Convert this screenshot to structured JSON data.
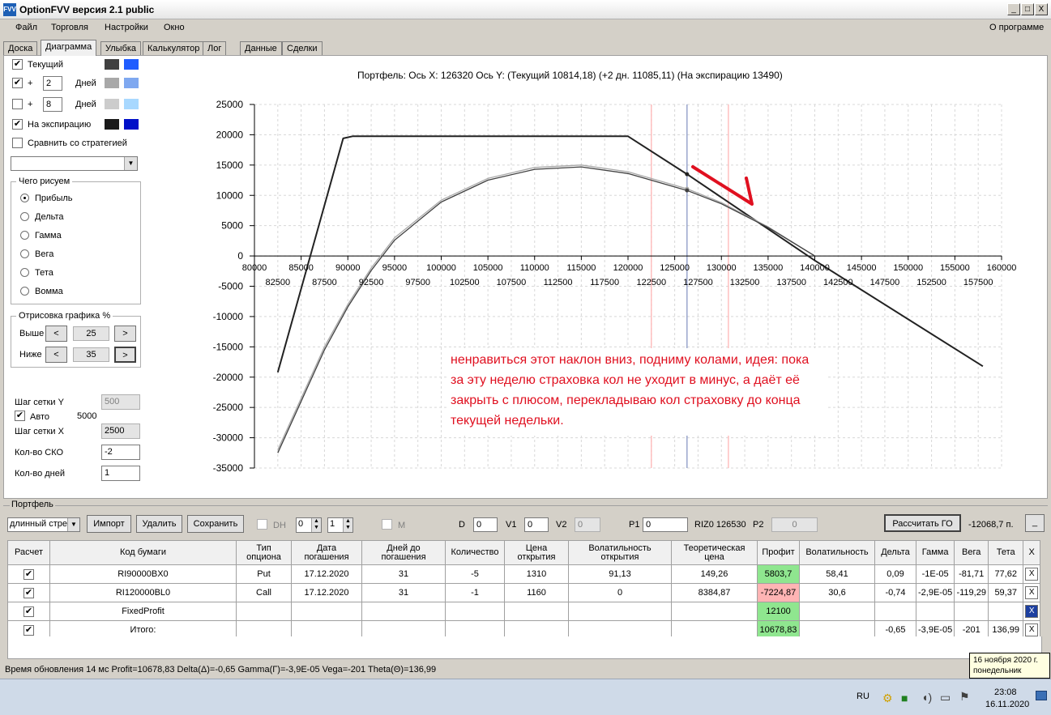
{
  "window": {
    "title": "OptionFVV версия 2.1 public",
    "icon_name": "app-logo-icon",
    "min_label": "_",
    "max_label": "□",
    "close_label": "X"
  },
  "menu": {
    "items": [
      "Файл",
      "Торговля",
      "Настройки",
      "Окно"
    ],
    "about": "О программе"
  },
  "tabs": [
    "Доска",
    "Диаграмма",
    "Улыбка",
    "Калькулятор",
    "Лог",
    "Данные",
    "Сделки"
  ],
  "active_tab": "Диаграмма",
  "left_panel": {
    "current": {
      "label": "Текущий",
      "checked": true,
      "color1": "#404040",
      "color2": "#1f5cff"
    },
    "plus1": {
      "prefix": "+",
      "value": "2",
      "unit": "Дней",
      "checked": true,
      "color1": "#a8a8a8",
      "color2": "#7fa8f0"
    },
    "plus2": {
      "prefix": "+",
      "value": "8",
      "unit": "Дней",
      "checked": false,
      "color1": "#cccccc",
      "color2": "#a8d8ff"
    },
    "expiry": {
      "label": "На экспирацию",
      "checked": true,
      "color1": "#1a1a1a",
      "color2": "#0010c8"
    },
    "compare": {
      "label": "Сравнить со стратегией",
      "checked": false
    },
    "draw_group": {
      "title": "Чего рисуем",
      "options": [
        "Прибыль",
        "Дельта",
        "Гамма",
        "Вега",
        "Тета",
        "Вомма"
      ],
      "selected": "Прибыль"
    },
    "render_group": {
      "title": "Отрисовка графика %",
      "above_label": "Выше",
      "above_value": "25",
      "below_label": "Ниже",
      "below_value": "35",
      "left_arrow": "<",
      "right_arrow": ">"
    },
    "grid_y_label": "Шаг сетки Y",
    "grid_y_value": "500",
    "auto_label": "Авто",
    "auto_checked": true,
    "auto_value": "5000",
    "grid_x_label": "Шаг сетки X",
    "grid_x_value": "2500",
    "sko_label": "Кол-во СКО",
    "sko_value": "-2",
    "days_label": "Кол-во дней",
    "days_value": "1"
  },
  "chart_title": "Портфель: Ось X: 126320 Ось Y:  (Текущий 10814,18)  (+2 дн. 11085,11)  (На экспирацию 13490)",
  "annotation": "ненравиться этот наклон вниз, подниму колами, идея: пока за эту неделю страховка кол не уходит в минус, а даёт её закрыть с плюсом, перекладываю кол страховку до конца текущей недельки.",
  "chart_data": {
    "type": "line",
    "xlim": [
      80000,
      160000
    ],
    "ylim": [
      -35000,
      25000
    ],
    "x_ticks_top": [
      "80000",
      "85000",
      "90000",
      "95000",
      "100000",
      "105000",
      "110000",
      "115000",
      "120000",
      "125000",
      "130000",
      "135000",
      "140000",
      "145000",
      "150000",
      "155000",
      "160000"
    ],
    "x_ticks_bottom": [
      "82500",
      "87500",
      "92500",
      "97500",
      "102500",
      "107500",
      "112500",
      "117500",
      "122500",
      "127500",
      "132500",
      "137500",
      "142500",
      "147500",
      "152500",
      "157500"
    ],
    "y_ticks": [
      "25000",
      "20000",
      "15000",
      "10000",
      "5000",
      "0",
      "-5000",
      "-10000",
      "-15000",
      "-20000",
      "-25000",
      "-30000",
      "-35000"
    ],
    "cursor_x": 126320,
    "red_lines_x": [
      122500,
      130750
    ],
    "series": [
      {
        "color": "#222222",
        "x": [
          82500,
          89500,
          90500,
          120000,
          126320,
          140000,
          158000
        ],
        "y": [
          -19200,
          19400,
          19750,
          19750,
          13490,
          -750,
          -18200
        ]
      },
      {
        "color": "#a8a8a8",
        "x": [
          82500,
          85000,
          87500,
          90000,
          92500,
          95000,
          100000,
          105000,
          110000,
          115000,
          120000,
          126320,
          130000,
          135000,
          140000
        ],
        "y": [
          -32000,
          -23500,
          -15000,
          -8000,
          -2000,
          3000,
          9200,
          12800,
          14600,
          15000,
          13900,
          11085,
          8800,
          4800,
          0
        ]
      },
      {
        "color": "#404040",
        "x": [
          82500,
          85000,
          87500,
          90000,
          92500,
          95000,
          100000,
          105000,
          110000,
          115000,
          120000,
          126320,
          130000,
          135000,
          140000
        ],
        "y": [
          -32500,
          -24000,
          -15500,
          -8400,
          -2400,
          2600,
          8900,
          12500,
          14300,
          14700,
          13600,
          10814,
          8600,
          4700,
          0
        ]
      }
    ],
    "arrow_color": "#e01020"
  },
  "portfolio": {
    "title": "Портфель",
    "strategy_select": "длинный стре",
    "import_button": "Импорт",
    "delete_button": "Удалить",
    "save_button": "Сохранить",
    "dh_label": "DH",
    "spin1": "0",
    "spin2": "1",
    "m_label": "M",
    "d_label": "D",
    "d_value": "0",
    "v1_label": "V1",
    "v1_value": "0",
    "v2_label": "V2",
    "v2_value": "0",
    "p1_label": "P1",
    "p1_value": "0",
    "riz_label": "RIZ0 126530",
    "p2_label": "P2",
    "p2_value": "0",
    "calc_button": "Рассчитать ГО",
    "go_value": "-12068,7 п.",
    "minimize_button": "_"
  },
  "table": {
    "headers": [
      "Расчет",
      "Код бумаги",
      "Тип опциона",
      "Дата погашения",
      "Дней до погашения",
      "Количество",
      "Цена открытия",
      "Волатильность открытия",
      "Теоретическая цена",
      "Профит",
      "Волатильность",
      "Дельта",
      "Гамма",
      "Вега",
      "Тета",
      "X"
    ],
    "rows": [
      {
        "checked": true,
        "code": "RI90000BX0",
        "type": "Put",
        "date": "17.12.2020",
        "days": "31",
        "qty": "-5",
        "open_price": "1310",
        "open_vol": "91,13",
        "theo": "149,26",
        "profit": "5803,7",
        "profit_state": "green",
        "vol": "58,41",
        "delta": "0,09",
        "gamma": "-1E-05",
        "vega": "-81,71",
        "theta": "77,62",
        "x": "X",
        "x_state": "normal"
      },
      {
        "checked": true,
        "code": "RI120000BL0",
        "type": "Call",
        "date": "17.12.2020",
        "days": "31",
        "qty": "-1",
        "open_price": "1160",
        "open_vol": "0",
        "theo": "8384,87",
        "profit": "-7224,87",
        "profit_state": "red",
        "vol": "30,6",
        "delta": "-0,74",
        "gamma": "-2,9E-05",
        "vega": "-119,29",
        "theta": "59,37",
        "x": "X",
        "x_state": "normal"
      },
      {
        "checked": true,
        "code": "FixedProfit",
        "type": "",
        "date": "",
        "days": "",
        "qty": "",
        "open_price": "",
        "open_vol": "",
        "theo": "",
        "profit": "12100",
        "profit_state": "green",
        "vol": "",
        "delta": "",
        "gamma": "",
        "vega": "",
        "theta": "",
        "x": "X",
        "x_state": "blue"
      },
      {
        "checked": true,
        "code": "Итого:",
        "type": "",
        "date": "",
        "days": "",
        "qty": "",
        "open_price": "",
        "open_vol": "",
        "theo": "",
        "profit": "10678,83",
        "profit_state": "green",
        "vol": "",
        "delta": "-0,65",
        "gamma": "-3,9E-05",
        "vega": "-201",
        "theta": "136,99",
        "x": "X",
        "x_state": "normal"
      }
    ]
  },
  "status": "Время обновления 14 мс  Profit=10678,83 Delta(Δ)=-0,65 Gamma(Γ)=-3,9E-05 Vega=-201 Theta(Θ)=136,99",
  "tooltip": {
    "line1": "16 ноября 2020 г.",
    "line2": "понедельник"
  },
  "taskbar": {
    "lang": "RU",
    "time": "23:08",
    "date": "16.11.2020"
  }
}
